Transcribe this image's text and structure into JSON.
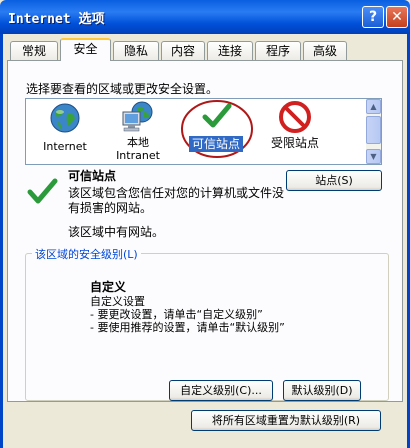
{
  "window": {
    "title": "Internet 选项",
    "help_glyph": "?",
    "close_glyph": "✕"
  },
  "tabs": [
    {
      "label": "常规",
      "active": false
    },
    {
      "label": "安全",
      "active": true
    },
    {
      "label": "隐私",
      "active": false
    },
    {
      "label": "内容",
      "active": false
    },
    {
      "label": "连接",
      "active": false
    },
    {
      "label": "程序",
      "active": false
    },
    {
      "label": "高级",
      "active": false
    }
  ],
  "security": {
    "instruction": "选择要查看的区域或更改安全设置。",
    "zones": [
      {
        "label": "Internet",
        "icon": "globe-icon"
      },
      {
        "label": "本地 Intranet",
        "icon": "local-intranet-icon"
      },
      {
        "label": "可信站点",
        "icon": "checkmark-icon",
        "selected": true
      },
      {
        "label": "受限站点",
        "icon": "restricted-icon"
      }
    ],
    "sites_button": "站点(S)",
    "selected_zone": {
      "title": "可信站点",
      "description": "该区域包含您信任对您的计算机或文件没有损害的网站。",
      "note": "该区域中有网站。"
    },
    "level_group": {
      "label": "该区域的安全级别(L)",
      "level_name": "自定义",
      "level_lines": "自定义设置\n- 要更改设置，请单击“自定义级别”\n- 要使用推荐的设置，请单击“默认级别”"
    },
    "custom_level_button": "自定义级别(C)...",
    "default_level_button": "默认级别(D)",
    "reset_all_button": "将所有区域重置为默认级别(R)"
  },
  "colors": {
    "titlebar": "#0a5fe0",
    "selection": "#316ac5",
    "annotation_circle": "#b01818",
    "group_label": "#0046d5"
  }
}
